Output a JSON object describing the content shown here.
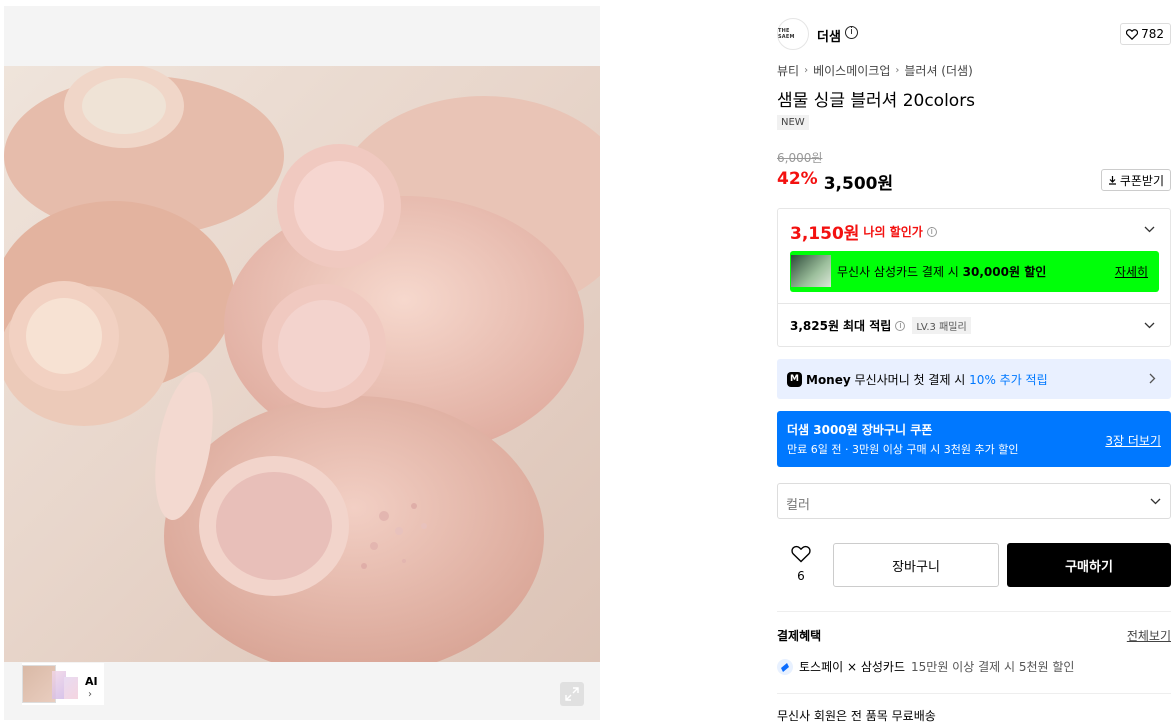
{
  "gallery": {
    "thumb_ai_label": "AI",
    "thumb_ai_chevron": "›",
    "expand_icon": "expand-icon"
  },
  "brand": {
    "logo_text": "THE SAEM",
    "name": "더샘",
    "info_glyph": "i",
    "like_count": "782"
  },
  "breadcrumb": {
    "items": [
      "뷰티",
      "베이스메이크업",
      "블러셔 (더샘)"
    ],
    "separator": "›"
  },
  "product": {
    "title": "샘물 싱글 블러셔 20colors",
    "badge": "NEW",
    "original_price": "6,000원",
    "discount_rate": "42%",
    "price": "3,500원",
    "coupon_button": "쿠폰받기"
  },
  "my_price": {
    "price": "3,150원",
    "label": "나의 할인가",
    "info_glyph": "i"
  },
  "card_banner": {
    "text_prefix": "무신사 삼성카드 결제 시 ",
    "text_bold": "30,000원 할인",
    "link": "자세히",
    "bg_color": "#00ff09"
  },
  "points": {
    "amount": "3,825원",
    "label": "최대 적립",
    "level_badge": "LV.3 패밀리"
  },
  "money_bar": {
    "icon_letter": "M",
    "brand": "Money",
    "text": "무신사머니 첫 결제 시",
    "highlight": "10% 추가 적립"
  },
  "coupon_bar": {
    "title": "더샘 3000원 장바구니 쿠폰",
    "subtitle": "만료 6일 전 · 3만원 이상 구매 시 3천원 추가 할인",
    "link": "3장 더보기",
    "bg_color": "#0078ff"
  },
  "option": {
    "placeholder": "컬러"
  },
  "actions": {
    "wish_count": "6",
    "cart": "장바구니",
    "buy": "구매하기"
  },
  "payment": {
    "title": "결제혜택",
    "more": "전체보기",
    "toss_brand": "토스페이 × 삼성카드",
    "toss_text": "15만원 이상 결제 시 5천원 할인"
  },
  "shipping": {
    "text": "무신사 회원은 전 품목 무료배송"
  },
  "colors": {
    "accent_red": "#f31110",
    "accent_blue": "#0078ff",
    "money_bg": "#e9f0ff"
  }
}
